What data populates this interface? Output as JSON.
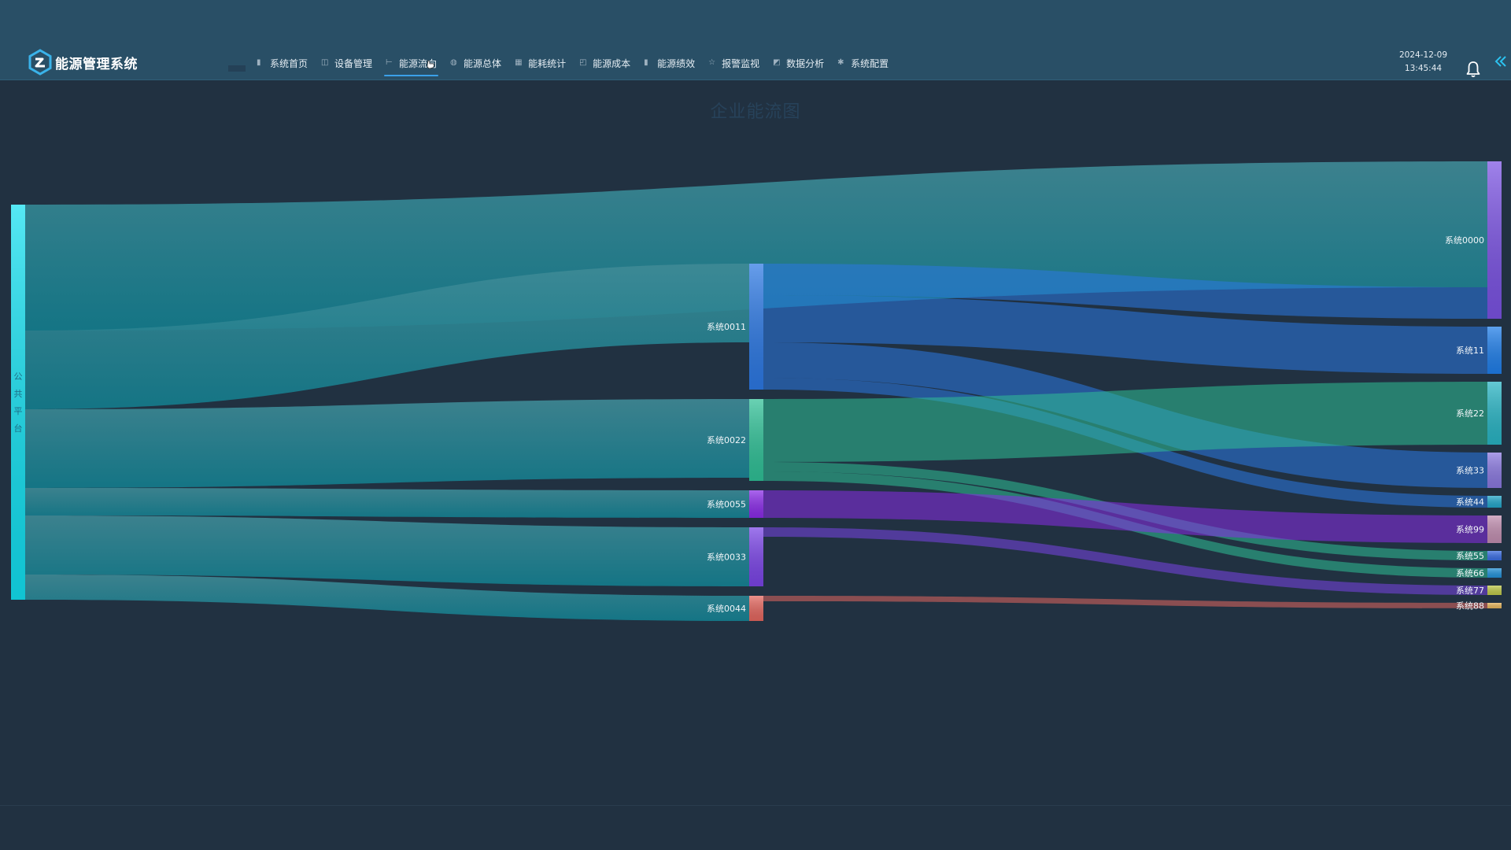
{
  "app": {
    "title": "能源管理系统"
  },
  "nav": {
    "items": [
      {
        "label": "系统首页",
        "icon": "bar-chart-icon",
        "active": false
      },
      {
        "label": "设备管理",
        "icon": "device-icon",
        "active": false
      },
      {
        "label": "能源流向",
        "icon": "flow-icon",
        "active": true
      },
      {
        "label": "能源总体",
        "icon": "database-icon",
        "active": false
      },
      {
        "label": "能耗统计",
        "icon": "table-icon",
        "active": false
      },
      {
        "label": "能源成本",
        "icon": "document-icon",
        "active": false
      },
      {
        "label": "能源绩效",
        "icon": "bar-chart-icon",
        "active": false
      },
      {
        "label": "报警监视",
        "icon": "alarm-icon",
        "active": false
      },
      {
        "label": "数据分析",
        "icon": "report-icon",
        "active": false
      },
      {
        "label": "系统配置",
        "icon": "gear-icon",
        "active": false
      }
    ]
  },
  "header": {
    "date": "2024-12-09",
    "time": "13:45:44"
  },
  "colors": {
    "topbar": "#294f66",
    "background": "#213141",
    "link": "#1d8a9a",
    "accent": "#3aa0e8"
  },
  "chart_data": {
    "type": "sankey",
    "title": "企业能流图",
    "nodes": [
      {
        "name": "公共平台",
        "color": "#13dff0"
      },
      {
        "name": "系统0011",
        "color": "#2c78e3"
      },
      {
        "name": "系统0022",
        "color": "#2fc096"
      },
      {
        "name": "系统0055",
        "color": "#8a2be8"
      },
      {
        "name": "系统0033",
        "color": "#7a44e6"
      },
      {
        "name": "系统0044",
        "color": "#e3665e"
      },
      {
        "name": "系统0000",
        "color": "#7a52e2"
      },
      {
        "name": "系统11",
        "color": "#1f7ee9"
      },
      {
        "name": "系统22",
        "color": "#28b4c4"
      },
      {
        "name": "系统33",
        "color": "#8a78df"
      },
      {
        "name": "系统44",
        "color": "#22a6c9"
      },
      {
        "name": "系统99",
        "color": "#c18eb0"
      },
      {
        "name": "系统55",
        "color": "#3a6de2"
      },
      {
        "name": "系统66",
        "color": "#2291d9"
      },
      {
        "name": "系统77",
        "color": "#bfc949"
      },
      {
        "name": "系统88",
        "color": "#e6b55c"
      }
    ],
    "links": [
      {
        "source": "公共平台",
        "target": "系统0000",
        "value": 160
      },
      {
        "source": "公共平台",
        "target": "系统0011",
        "value": 100
      },
      {
        "source": "公共平台",
        "target": "系统0022",
        "value": 100
      },
      {
        "source": "公共平台",
        "target": "系统0055",
        "value": 35
      },
      {
        "source": "公共平台",
        "target": "系统0033",
        "value": 75
      },
      {
        "source": "公共平台",
        "target": "系统0044",
        "value": 32
      },
      {
        "source": "系统0011",
        "target": "系统0000",
        "value": 40
      },
      {
        "source": "系统0011",
        "target": "系统11",
        "value": 60
      },
      {
        "source": "系统0011",
        "target": "系统33",
        "value": 45
      },
      {
        "source": "系统0011",
        "target": "系统44",
        "value": 15
      },
      {
        "source": "系统0022",
        "target": "系统22",
        "value": 80
      },
      {
        "source": "系统0022",
        "target": "系统55",
        "value": 12
      },
      {
        "source": "系统0022",
        "target": "系统66",
        "value": 12
      },
      {
        "source": "系统0055",
        "target": "系统99",
        "value": 35
      },
      {
        "source": "系统0033",
        "target": "系统77",
        "value": 12
      },
      {
        "source": "系统0044",
        "target": "系统88",
        "value": 7
      }
    ]
  }
}
